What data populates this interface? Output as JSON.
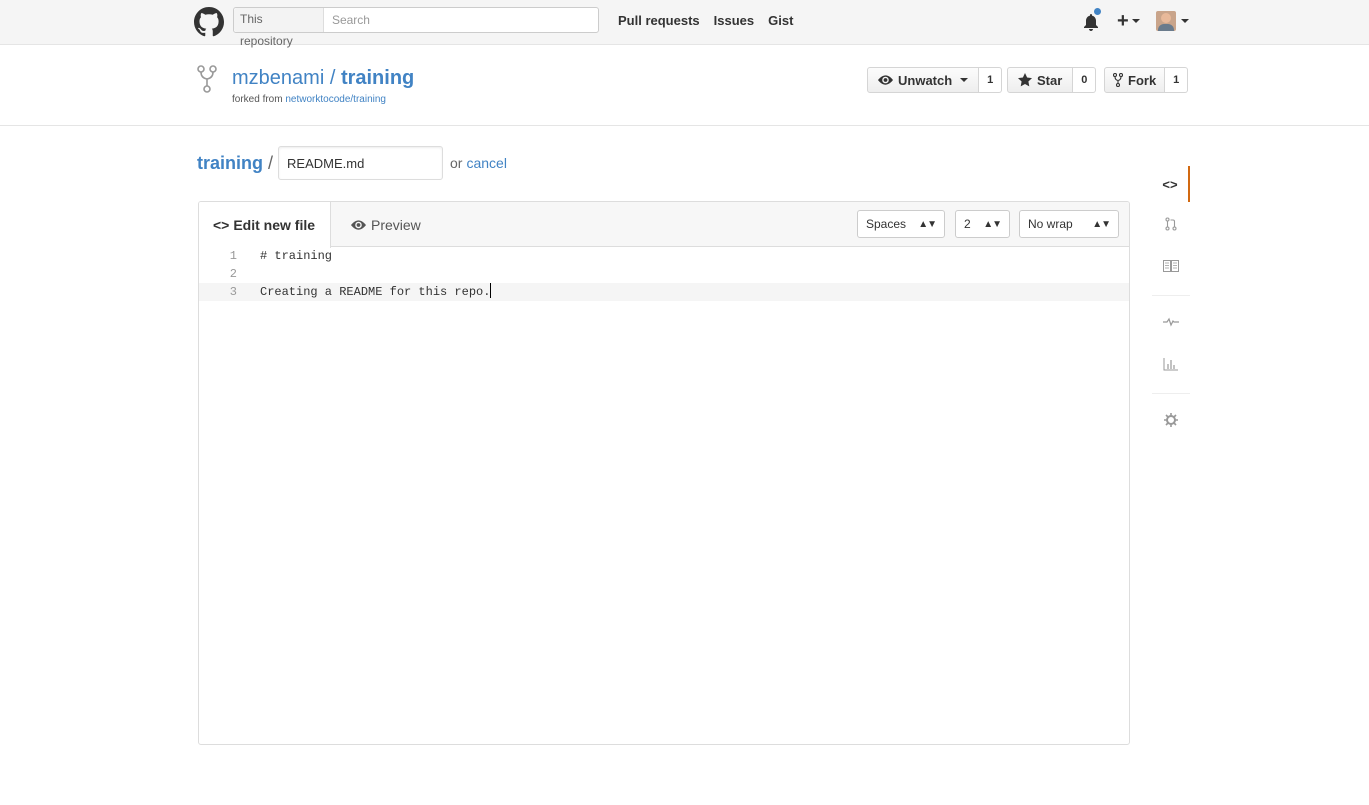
{
  "header": {
    "search_scope": "This repository",
    "search_placeholder": "Search",
    "nav": [
      "Pull requests",
      "Issues",
      "Gist"
    ]
  },
  "repo": {
    "owner": "mzbenami",
    "separator": " / ",
    "name": "training",
    "forked_from_prefix": "forked from ",
    "forked_from": "networktocode/training",
    "unwatch_label": "Unwatch",
    "watch_count": "1",
    "star_label": "Star",
    "star_count": "0",
    "fork_label": "Fork",
    "fork_count": "1"
  },
  "breadcrumb": {
    "repo": "training",
    "slash": "/",
    "filename": "README.md",
    "or": "or",
    "cancel": "cancel"
  },
  "editor": {
    "tab_edit": "Edit new file",
    "tab_preview": "Preview",
    "indent_mode": "Spaces",
    "indent_size": "2",
    "wrap_mode": "No wrap",
    "lines": [
      {
        "num": "1",
        "text": "# training"
      },
      {
        "num": "2",
        "text": ""
      },
      {
        "num": "3",
        "text": "Creating a README for this repo."
      }
    ]
  },
  "colors": {
    "link": "#4183c4",
    "selected_nav_accent": "#d26911"
  },
  "sidebar_icons": [
    "code-icon",
    "pull-request-icon",
    "wiki-icon",
    "pulse-icon",
    "graphs-icon",
    "settings-icon"
  ]
}
